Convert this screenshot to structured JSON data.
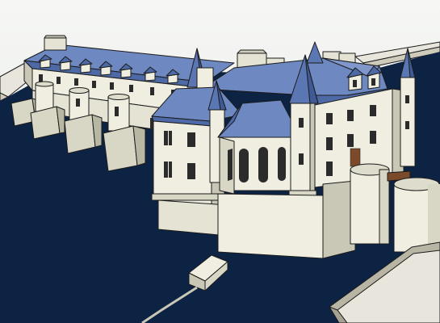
{
  "scene": {
    "subject": "chateau-3d-model",
    "style": "flat-shaded-sketch-render",
    "colors": {
      "sky_top": "#f6f7f5",
      "sky_bottom": "#dfe3df",
      "water": "#0d2344",
      "wall_light": "#efeee0",
      "wall_shade": "#c9c8b7",
      "wall_dark": "#a9a895",
      "roof_light": "#7a93c7",
      "roof_mid": "#5a76b3",
      "roof_dark": "#3f5a94",
      "window": "#2b2b2b",
      "door": "#7a4a2a",
      "bank": "#e8e6dc",
      "bank_top": "#b9b5a5"
    }
  }
}
